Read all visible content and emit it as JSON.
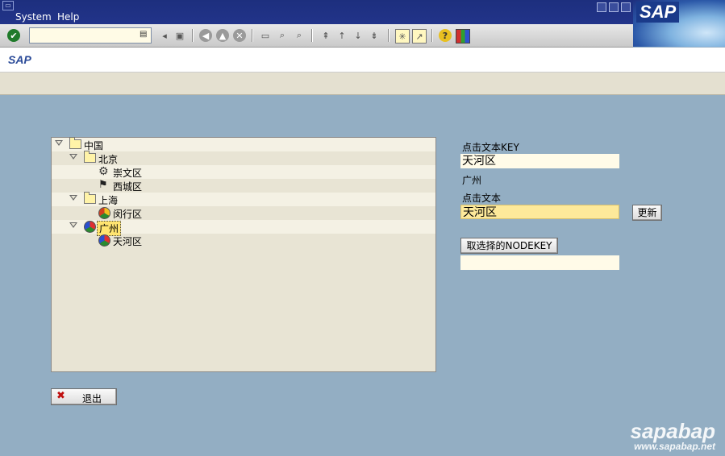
{
  "menubar": {
    "items": [
      "System",
      "Help"
    ]
  },
  "logo": {
    "text": "SAP"
  },
  "toolbar": {
    "icons": [
      "enter-icon",
      "save-icon",
      "back-icon",
      "exit-icon",
      "cancel-icon",
      "print-icon",
      "find-icon",
      "find-next-icon",
      "first-page-icon",
      "prev-page-icon",
      "next-page-icon",
      "last-page-icon",
      "create-session-icon",
      "shortcut-icon",
      "help-icon",
      "layout-menu-icon"
    ]
  },
  "title": {
    "text": "SAP"
  },
  "tree": {
    "nodes": [
      {
        "label": "中国",
        "level": 0,
        "icon": "folder",
        "expanded": true
      },
      {
        "label": "北京",
        "level": 1,
        "icon": "folder",
        "expanded": true
      },
      {
        "label": "崇文区",
        "level": 2,
        "icon": "gear"
      },
      {
        "label": "西城区",
        "level": 2,
        "icon": "flag"
      },
      {
        "label": "上海",
        "level": 1,
        "icon": "folder",
        "expanded": true
      },
      {
        "label": "闵行区",
        "level": 2,
        "icon": "ball-yellow"
      },
      {
        "label": "广州",
        "level": 1,
        "icon": "ball",
        "expanded": true,
        "selected": true
      },
      {
        "label": "天河区",
        "level": 2,
        "icon": "ball"
      }
    ]
  },
  "right": {
    "key_label": "点击文本KEY",
    "key_value": "天河区",
    "parent_text": "广州",
    "text_label": "点击文本",
    "text_value": "天河区",
    "update_button": "更新",
    "nodekey_button": "取选择的NODEKEY",
    "nodekey_value": ""
  },
  "exit_button": {
    "label": "退出"
  },
  "watermark": {
    "line1": "sapabap",
    "line2": "www.sapabap.net"
  }
}
